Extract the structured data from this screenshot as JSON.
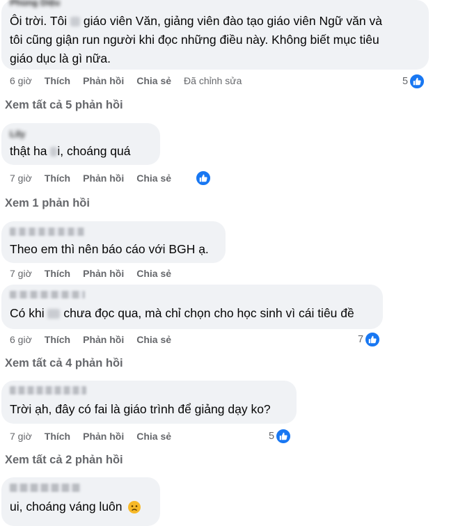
{
  "actions": {
    "like": "Thích",
    "reply": "Phản hồi",
    "share": "Chia sẻ"
  },
  "comments": [
    {
      "author": "Phùng Diệu",
      "lines": [
        "Ôi trời. Tôi",
        "giáo viên Văn, giảng viên đào tạo giáo viên Ngữ văn và",
        "tôi cũng giận run người khi đọc những điều này. Không biết mục tiêu",
        "giáo dục là gì nữa."
      ],
      "time": "6 giờ",
      "edited": "Đã chỉnh sửa",
      "reactions": "5"
    },
    {
      "author": "Lily",
      "text_a": "thật ha",
      "text_b": "i, choáng quá",
      "time": "7 giờ",
      "reactions": ""
    },
    {
      "author": "",
      "text": "Theo em thì nên báo cáo với BGH ạ.",
      "time": "7 giờ"
    },
    {
      "author": "",
      "text_a": "Có khi",
      "text_b": "chưa đọc qua, mà chỉ chọn cho học sinh vì cái tiêu đề",
      "time": "6 giờ",
      "reactions": "7"
    },
    {
      "author": "",
      "text": "Trời ạh, đây có fai là giáo trình để giảng dạy ko?",
      "time": "7 giờ",
      "reactions": "5"
    },
    {
      "author": "",
      "text": "ui, choáng váng luôn"
    }
  ],
  "see_more": [
    "Xem tất cả 5 phản hồi",
    "Xem 1 phản hồi",
    "Xem tất cả 4 phản hồi",
    "Xem tất cả 2 phản hồi"
  ],
  "colors": {
    "bubble": "#f0f2f5",
    "meta": "#65676b",
    "like_blue": "#1877f2"
  },
  "icons": {
    "like": "thumbs-up-icon",
    "emoji": "frowning-face-emoji"
  }
}
